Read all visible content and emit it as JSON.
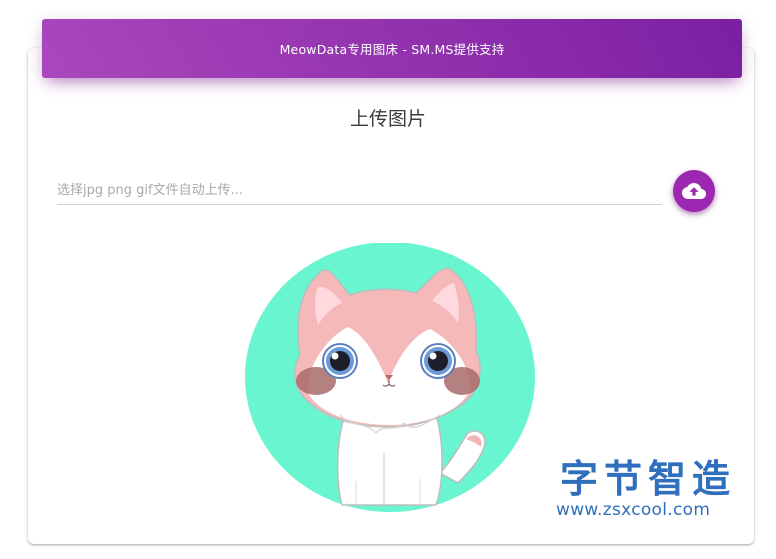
{
  "header": {
    "title": "MeowData专用图床 - SM.MS提供支持"
  },
  "upload": {
    "heading": "上传图片",
    "placeholder": "选择jpg png gif文件自动上传...",
    "button_icon": "cloud-upload-icon"
  },
  "preview": {
    "image": "cat-avatar"
  },
  "watermark": {
    "brand": "字节智造",
    "url": "www.zsxcool.com"
  },
  "colors": {
    "accent": "#9c27b0",
    "header_gradient_start": "#ab47bc",
    "header_gradient_end": "#7b1fa2",
    "avatar_background": "#69f5cf",
    "watermark": "#2f6fbd"
  }
}
